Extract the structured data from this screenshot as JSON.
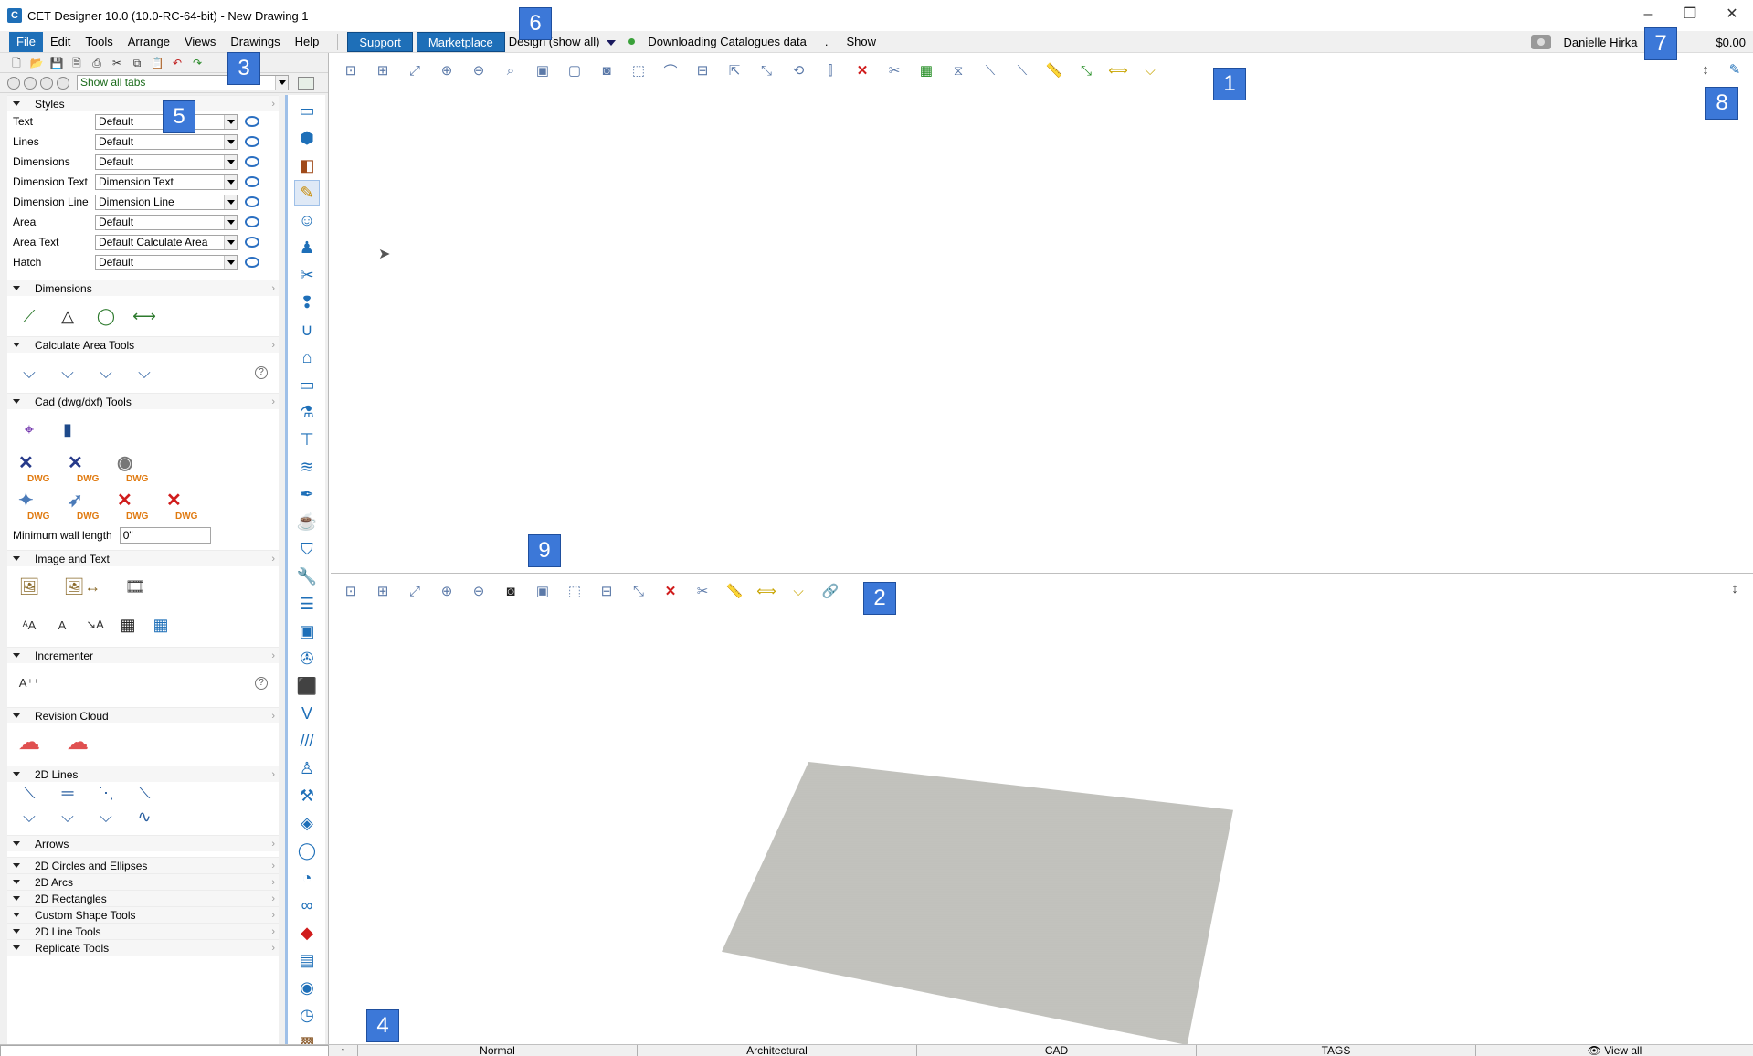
{
  "window": {
    "title": "CET Designer 10.0 (10.0-RC-64-bit) - New Drawing 1",
    "controls": [
      "–",
      "❐",
      "✕"
    ]
  },
  "menubar": {
    "items": [
      "File",
      "Edit",
      "Tools",
      "Arrange",
      "Views",
      "Drawings",
      "Help"
    ],
    "support_label": "Support",
    "marketplace_label": "Marketplace",
    "design_label": "Design (show all)",
    "download_status": "Downloading Catalogues data",
    "dot": ".",
    "show_label": "Show",
    "user_name": "Danielle Hirka",
    "price": "$0.00"
  },
  "leftpanel": {
    "tabs_selector": "Show all tabs",
    "styles": {
      "title": "Styles",
      "rows": [
        {
          "label": "Text",
          "value": "Default"
        },
        {
          "label": "Lines",
          "value": "Default"
        },
        {
          "label": "Dimensions",
          "value": "Default"
        },
        {
          "label": "Dimension Text",
          "value": "Dimension Text"
        },
        {
          "label": "Dimension Line",
          "value": "Dimension Line"
        },
        {
          "label": "Area",
          "value": "Default"
        },
        {
          "label": "Area Text",
          "value": "Default Calculate Area"
        },
        {
          "label": "Hatch",
          "value": "Default"
        }
      ]
    },
    "sections": {
      "dimensions": "Dimensions",
      "calculate_area": "Calculate Area Tools",
      "cad_tools": "Cad (dwg/dxf) Tools",
      "image_text": "Image and Text",
      "incrementer": "Incrementer",
      "revision_cloud": "Revision Cloud",
      "lines_2d": "2D Lines",
      "arrows": "Arrows",
      "collapsed": [
        "2D Circles and Ellipses",
        "2D Arcs",
        "2D Rectangles",
        "Custom Shape Tools",
        "2D Line Tools",
        "Replicate Tools"
      ]
    },
    "dwg_label": "DWG",
    "min_wall_label": "Minimum wall length",
    "min_wall_value": "0\"",
    "help_glyph": "?"
  },
  "statusbar": {
    "items": [
      "Normal",
      "Architectural",
      "CAD",
      "TAGS"
    ],
    "view_all": "View all"
  },
  "callouts": [
    "1",
    "2",
    "3",
    "4",
    "5",
    "6",
    "7",
    "8",
    "9"
  ]
}
